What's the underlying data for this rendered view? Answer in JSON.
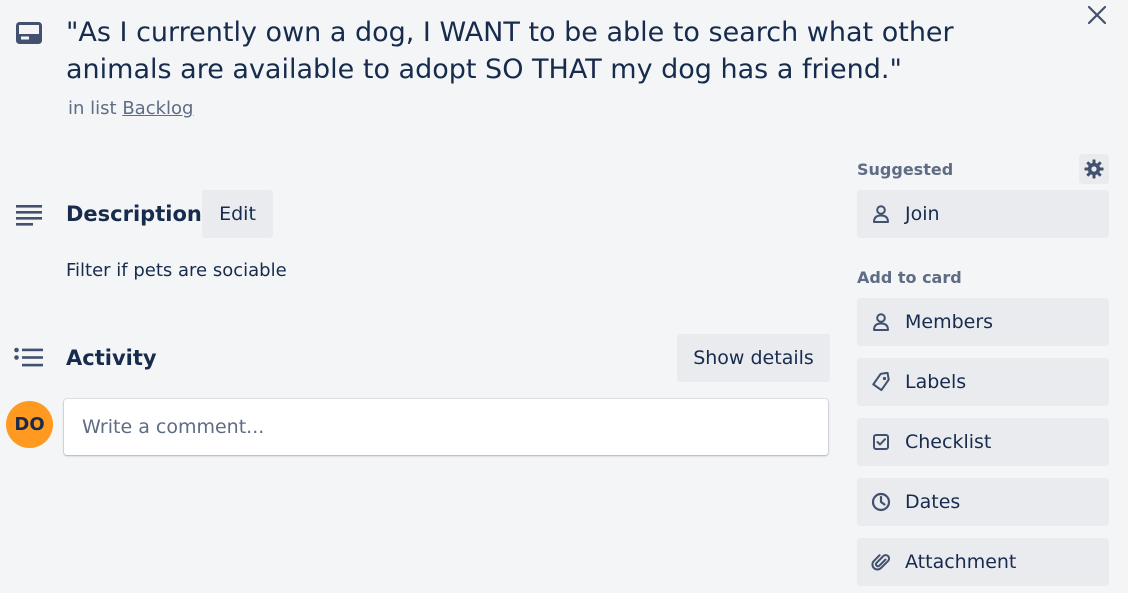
{
  "card": {
    "title": "\"As I currently own a dog, I WANT to be able to search what other animals are available to adopt SO THAT my dog has a friend.\"",
    "in_list_prefix": "in list",
    "list_name": "Backlog"
  },
  "description": {
    "heading": "Description",
    "edit_label": "Edit",
    "text": "Filter if pets are sociable"
  },
  "activity": {
    "heading": "Activity",
    "show_details_label": "Show details",
    "avatar_initials": "DO",
    "comment_placeholder": "Write a comment..."
  },
  "sidebar": {
    "suggested_label": "Suggested",
    "suggested_items": [
      {
        "label": "Join",
        "icon": "person-icon"
      }
    ],
    "add_to_card_label": "Add to card",
    "add_items": [
      {
        "label": "Members",
        "icon": "person-icon"
      },
      {
        "label": "Labels",
        "icon": "tag-icon"
      },
      {
        "label": "Checklist",
        "icon": "checkbox-icon"
      },
      {
        "label": "Dates",
        "icon": "clock-icon"
      },
      {
        "label": "Attachment",
        "icon": "paperclip-icon"
      }
    ]
  },
  "colors": {
    "background": "#f4f5f7",
    "text": "#172b4d",
    "muted": "#5e6c84",
    "button": "#e9ebee",
    "avatar": "#ff991f"
  }
}
